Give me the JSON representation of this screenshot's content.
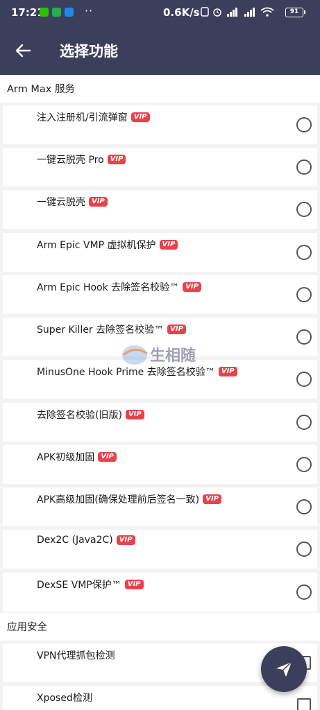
{
  "status_bar": {
    "time": "17:21",
    "dots": "··",
    "net_speed": "0.6K/s",
    "battery": "91"
  },
  "app_bar": {
    "title": "选择功能"
  },
  "sections": [
    {
      "title": "Arm Max 服务",
      "items": [
        {
          "label": "注入注册机/引流弹窗",
          "vip": "VIP"
        },
        {
          "label": "一键云脱壳 Pro",
          "vip": "VIP"
        },
        {
          "label": "一键云脱壳",
          "vip": "VIP"
        },
        {
          "label": "Arm Epic VMP 虚拟机保护",
          "vip": "VIP"
        },
        {
          "label": "Arm Epic Hook 去除签名校验™",
          "vip": "VIP"
        },
        {
          "label": "Super Killer 去除签名校验™",
          "vip": "VIP"
        },
        {
          "label": "MinusOne Hook Prime 去除签名校验™",
          "vip": "VIP"
        },
        {
          "label": "去除签名校验(旧版)",
          "vip": "VIP"
        },
        {
          "label": "APK初级加固",
          "vip": "VIP"
        },
        {
          "label": "APK高级加固(确保处理前后签名一致)",
          "vip": "VIP"
        },
        {
          "label": "Dex2C (Java2C)",
          "vip": "VIP"
        },
        {
          "label": "DexSE VMP保护™",
          "vip": "VIP"
        }
      ]
    },
    {
      "title": "应用安全",
      "items": [
        {
          "label": "VPN代理抓包检测"
        },
        {
          "label": "Xposed检测"
        }
      ]
    }
  ],
  "watermark": {
    "text": "生相随"
  },
  "colors": {
    "primary": "#3b3f5c",
    "vip_badge": "#e8424a",
    "background": "#f3f3f3"
  },
  "icons": {
    "back": "arrow-left-icon",
    "fab": "send-icon"
  }
}
